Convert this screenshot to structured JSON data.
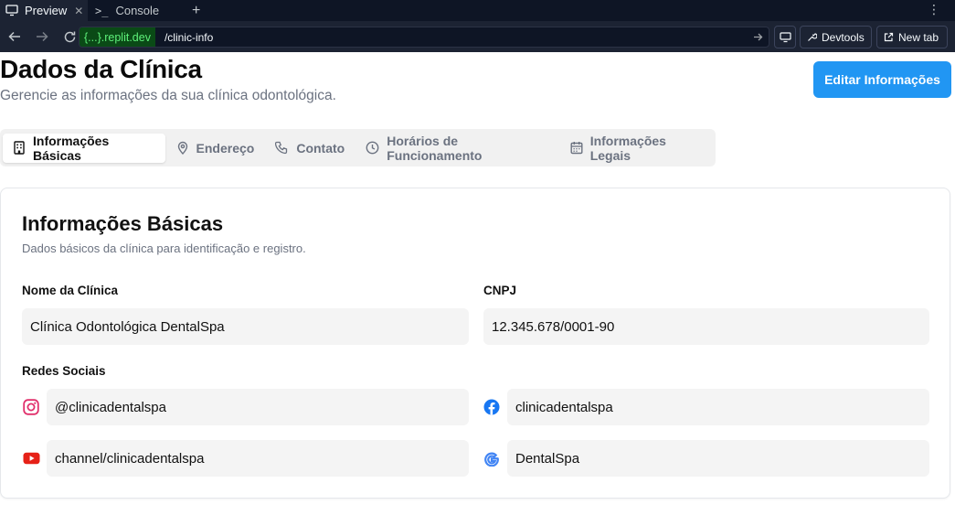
{
  "chrome": {
    "tabs": [
      {
        "label": "Preview",
        "icon": "monitor-icon",
        "active": true
      },
      {
        "label": "Console",
        "icon": "terminal-icon",
        "active": false
      }
    ],
    "url_domain": "{...}.replit.dev",
    "url_path": "/clinic-info",
    "devtools_label": "Devtools",
    "new_tab_label": "New tab"
  },
  "header": {
    "title": "Dados da Clínica",
    "subtitle": "Gerencie as informações da sua clínica odontológica.",
    "edit_label": "Editar Informações"
  },
  "tabs": [
    {
      "label": "Informações Básicas",
      "icon": "building-icon",
      "active": true
    },
    {
      "label": "Endereço",
      "icon": "map-pin-icon",
      "active": false
    },
    {
      "label": "Contato",
      "icon": "phone-icon",
      "active": false
    },
    {
      "label": "Horários de Funcionamento",
      "icon": "clock-icon",
      "active": false
    },
    {
      "label": "Informações Legais",
      "icon": "calendar-icon",
      "active": false
    }
  ],
  "card": {
    "title": "Informações Básicas",
    "subtitle": "Dados básicos da clínica para identificação e registro.",
    "name_label": "Nome da Clínica",
    "name_value": "Clínica Odontológica DentalSpa",
    "cnpj_label": "CNPJ",
    "cnpj_value": "12.345.678/0001-90",
    "social_label": "Redes Sociais",
    "social": {
      "instagram": "@clinicadentalspa",
      "facebook": "clinicadentalspa",
      "youtube": "channel/clinicadentalspa",
      "google": "DentalSpa"
    }
  },
  "colors": {
    "accent": "#2196f3",
    "instagram": "#e1306c",
    "facebook": "#1877f2",
    "youtube": "#e62117",
    "google_blue": "#4285f4"
  }
}
